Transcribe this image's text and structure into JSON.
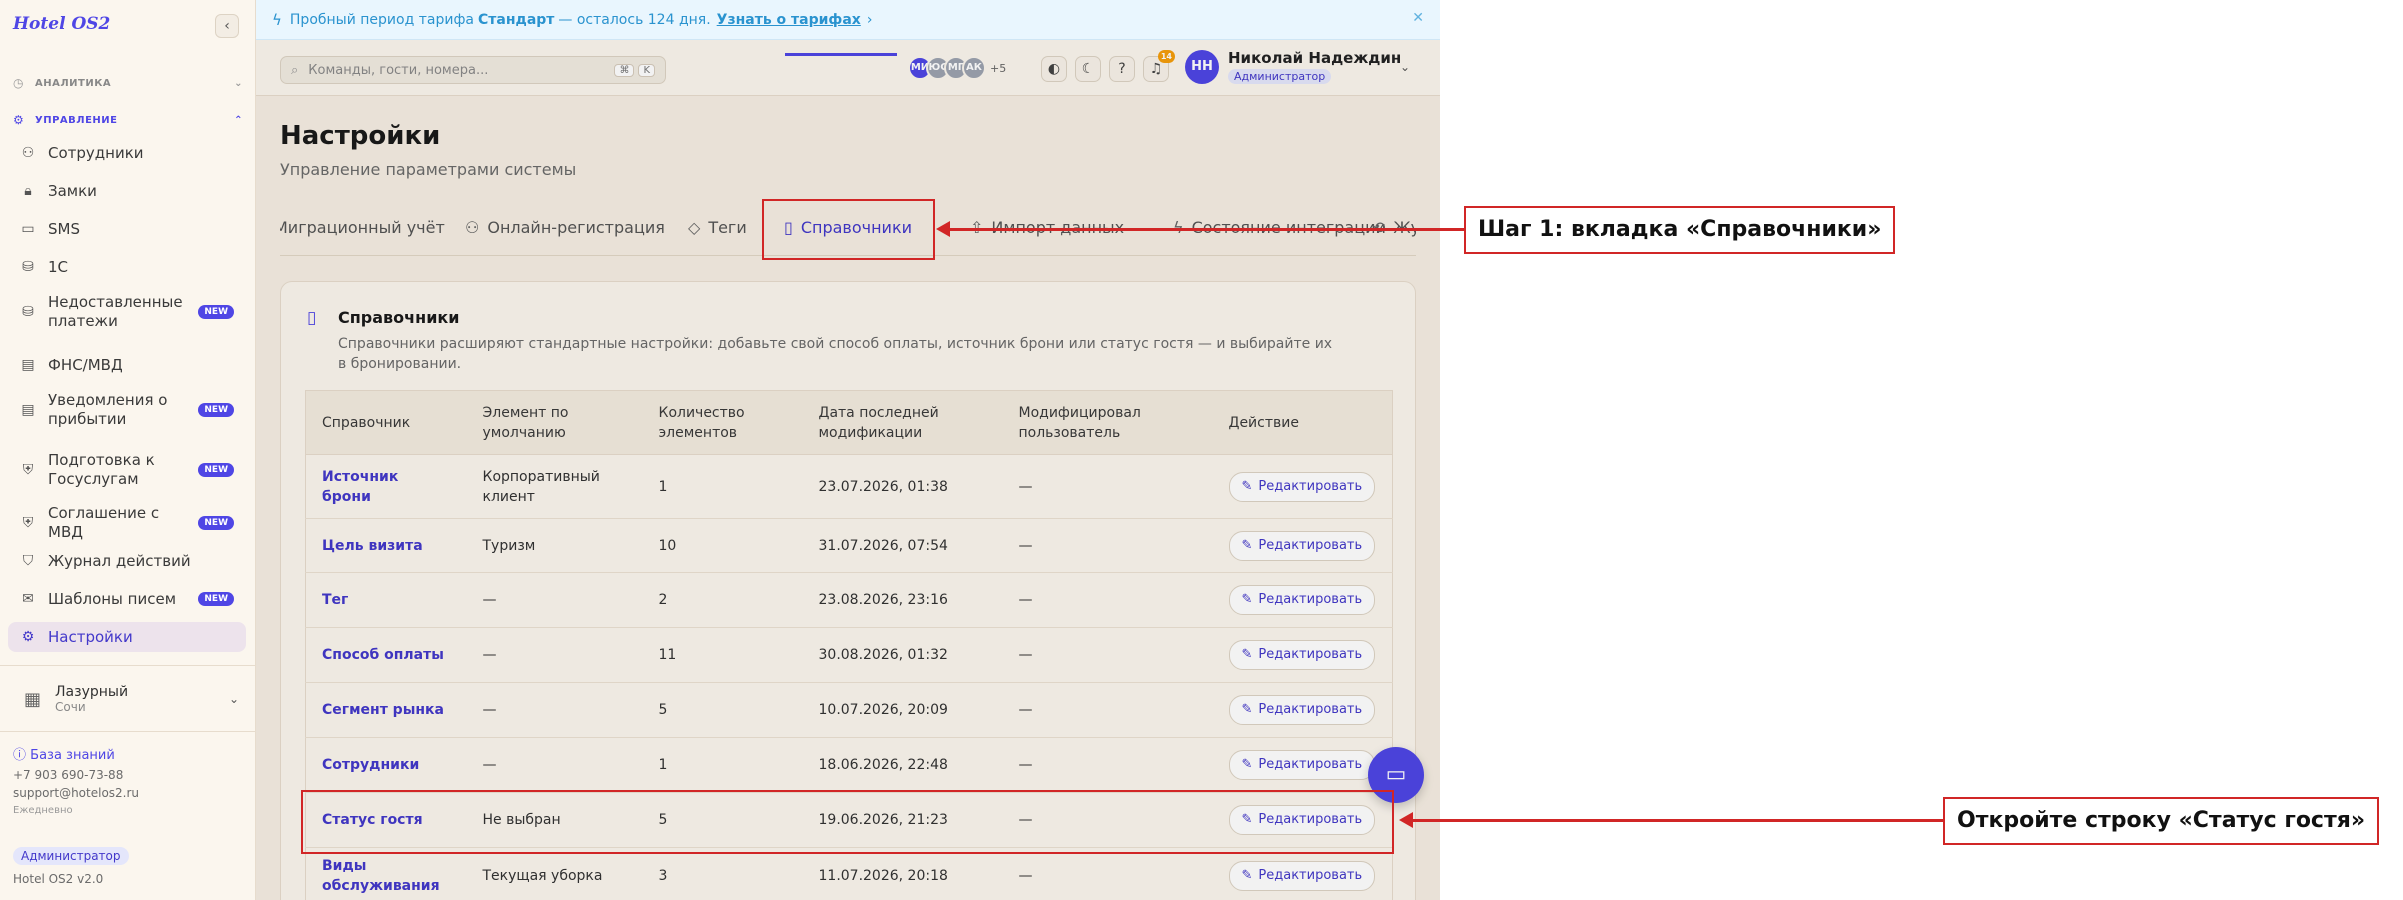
{
  "sidebar": {
    "brand": "Hotel OS2",
    "collapse_icon": "‹",
    "sections": {
      "analytics": "АНАЛИТИКА",
      "management": "УПРАВЛЕНИЕ"
    },
    "items": [
      {
        "label": "Сотрудники",
        "icon": "users-icon",
        "glyph": "⚇",
        "new": ""
      },
      {
        "label": "Замки",
        "icon": "lock-icon",
        "glyph": "🔒︎",
        "new": ""
      },
      {
        "label": "SMS",
        "icon": "message-icon",
        "glyph": "▭",
        "new": ""
      },
      {
        "label": "1С",
        "icon": "database-icon",
        "glyph": "⛁",
        "new": ""
      },
      {
        "label": "Недоставленные платежи",
        "icon": "database-icon",
        "glyph": "⛁",
        "new": "NEW"
      },
      {
        "label": "ФНС/МВД",
        "icon": "document-icon",
        "glyph": "▤",
        "new": ""
      },
      {
        "label": "Уведомления о прибытии",
        "icon": "file-icon",
        "glyph": "▤",
        "new": "NEW"
      },
      {
        "label": "Подготовка к Госуслугам",
        "icon": "shield-check-icon",
        "glyph": "⛨",
        "new": "NEW"
      },
      {
        "label": "Соглашение с МВД",
        "icon": "handshake-icon",
        "glyph": "⛨",
        "new": "NEW"
      },
      {
        "label": "Журнал действий",
        "icon": "shield-icon",
        "glyph": "⛉",
        "new": ""
      },
      {
        "label": "Шаблоны писем",
        "icon": "mail-icon",
        "glyph": "✉",
        "new": "NEW"
      },
      {
        "label": "Настройки",
        "icon": "gear-icon",
        "glyph": "⚙",
        "new": ""
      }
    ],
    "hotel": {
      "name": "Лазурный",
      "city": "Сочи"
    },
    "knowledge_base": "База знаний",
    "phone": "+7 903 690-73-88",
    "email": "support@hotelos2.ru",
    "schedule": "Ежедневно",
    "role": "Администратор",
    "version": "Hotel OS2 v2.0"
  },
  "banner": {
    "prefix": "Пробный период тарифа",
    "plan": "Стандарт",
    "suffix": "— осталось 124 дня.",
    "link": "Узнать о тарифах",
    "link_arrow": "›",
    "close": "✕"
  },
  "topbar": {
    "search_placeholder": "Команды, гости, номера...",
    "kbd": [
      "⌘",
      "K"
    ],
    "avatars": [
      {
        "initials": "МИ",
        "color": "#4f46e5"
      },
      {
        "initials": "ЮС",
        "color": "#9ca3af"
      },
      {
        "initials": "МГ",
        "color": "#9ca3af"
      },
      {
        "initials": "АК",
        "color": "#9ca3af"
      }
    ],
    "avatars_more": "+5",
    "notif_count": "14",
    "user": {
      "initials": "НН",
      "name": "Николай Надеждин",
      "role": "Администратор"
    }
  },
  "page": {
    "title": "Настройки",
    "subtitle": "Управление параметрами системы"
  },
  "tabs": [
    {
      "label": "Миграционный учёт",
      "glyph": "",
      "active": false
    },
    {
      "label": "Онлайн-регистрация",
      "glyph": "⚇",
      "active": false
    },
    {
      "label": "Теги",
      "glyph": "◇",
      "active": false
    },
    {
      "label": "Справочники",
      "glyph": "▯",
      "active": true
    },
    {
      "label": "Импорт данных",
      "glyph": "",
      "active": false
    },
    {
      "label": "Состояние интеграции",
      "glyph": "ϟ",
      "active": false
    },
    {
      "label": "Жу",
      "glyph": "⟲",
      "active": false
    }
  ],
  "card": {
    "title": "Справочники",
    "description": "Справочники расширяют стандартные настройки: добавьте свой способ оплаты, источник брони или статус гостя — и выбирайте их в бронировании.",
    "columns": [
      "Справочник",
      "Элемент по умолчанию",
      "Количество элементов",
      "Дата последней модификации",
      "Модифицировал пользователь",
      "Действие"
    ],
    "edit_label": "Редактировать",
    "rows": [
      {
        "name": "Источник брони",
        "default": "Корпоративный клиент",
        "count": "1",
        "date": "23.07.2026, 01:38",
        "user": "—"
      },
      {
        "name": "Цель визита",
        "default": "Туризм",
        "count": "10",
        "date": "31.07.2026, 07:54",
        "user": "—"
      },
      {
        "name": "Тег",
        "default": "—",
        "count": "2",
        "date": "23.08.2026, 23:16",
        "user": "—"
      },
      {
        "name": "Способ оплаты",
        "default": "—",
        "count": "11",
        "date": "30.08.2026, 01:32",
        "user": "—"
      },
      {
        "name": "Сегмент рынка",
        "default": "—",
        "count": "5",
        "date": "10.07.2026, 20:09",
        "user": "—"
      },
      {
        "name": "Сотрудники",
        "default": "—",
        "count": "1",
        "date": "18.06.2026, 22:48",
        "user": "—"
      },
      {
        "name": "Статус гостя",
        "default": "Не выбран",
        "count": "5",
        "date": "19.06.2026, 21:23",
        "user": "—"
      },
      {
        "name": "Виды обслуживания",
        "default": "Текущая уборка",
        "count": "3",
        "date": "11.07.2026, 20:18",
        "user": "—"
      }
    ]
  },
  "annotations": {
    "step1": "Шаг 1: вкладка «Справочники»",
    "step2": "Откройте строку «Статус гостя»"
  },
  "colors": {
    "accent": "#4f46e5",
    "annotation": "#d12626",
    "banner": "#2a93cf"
  }
}
